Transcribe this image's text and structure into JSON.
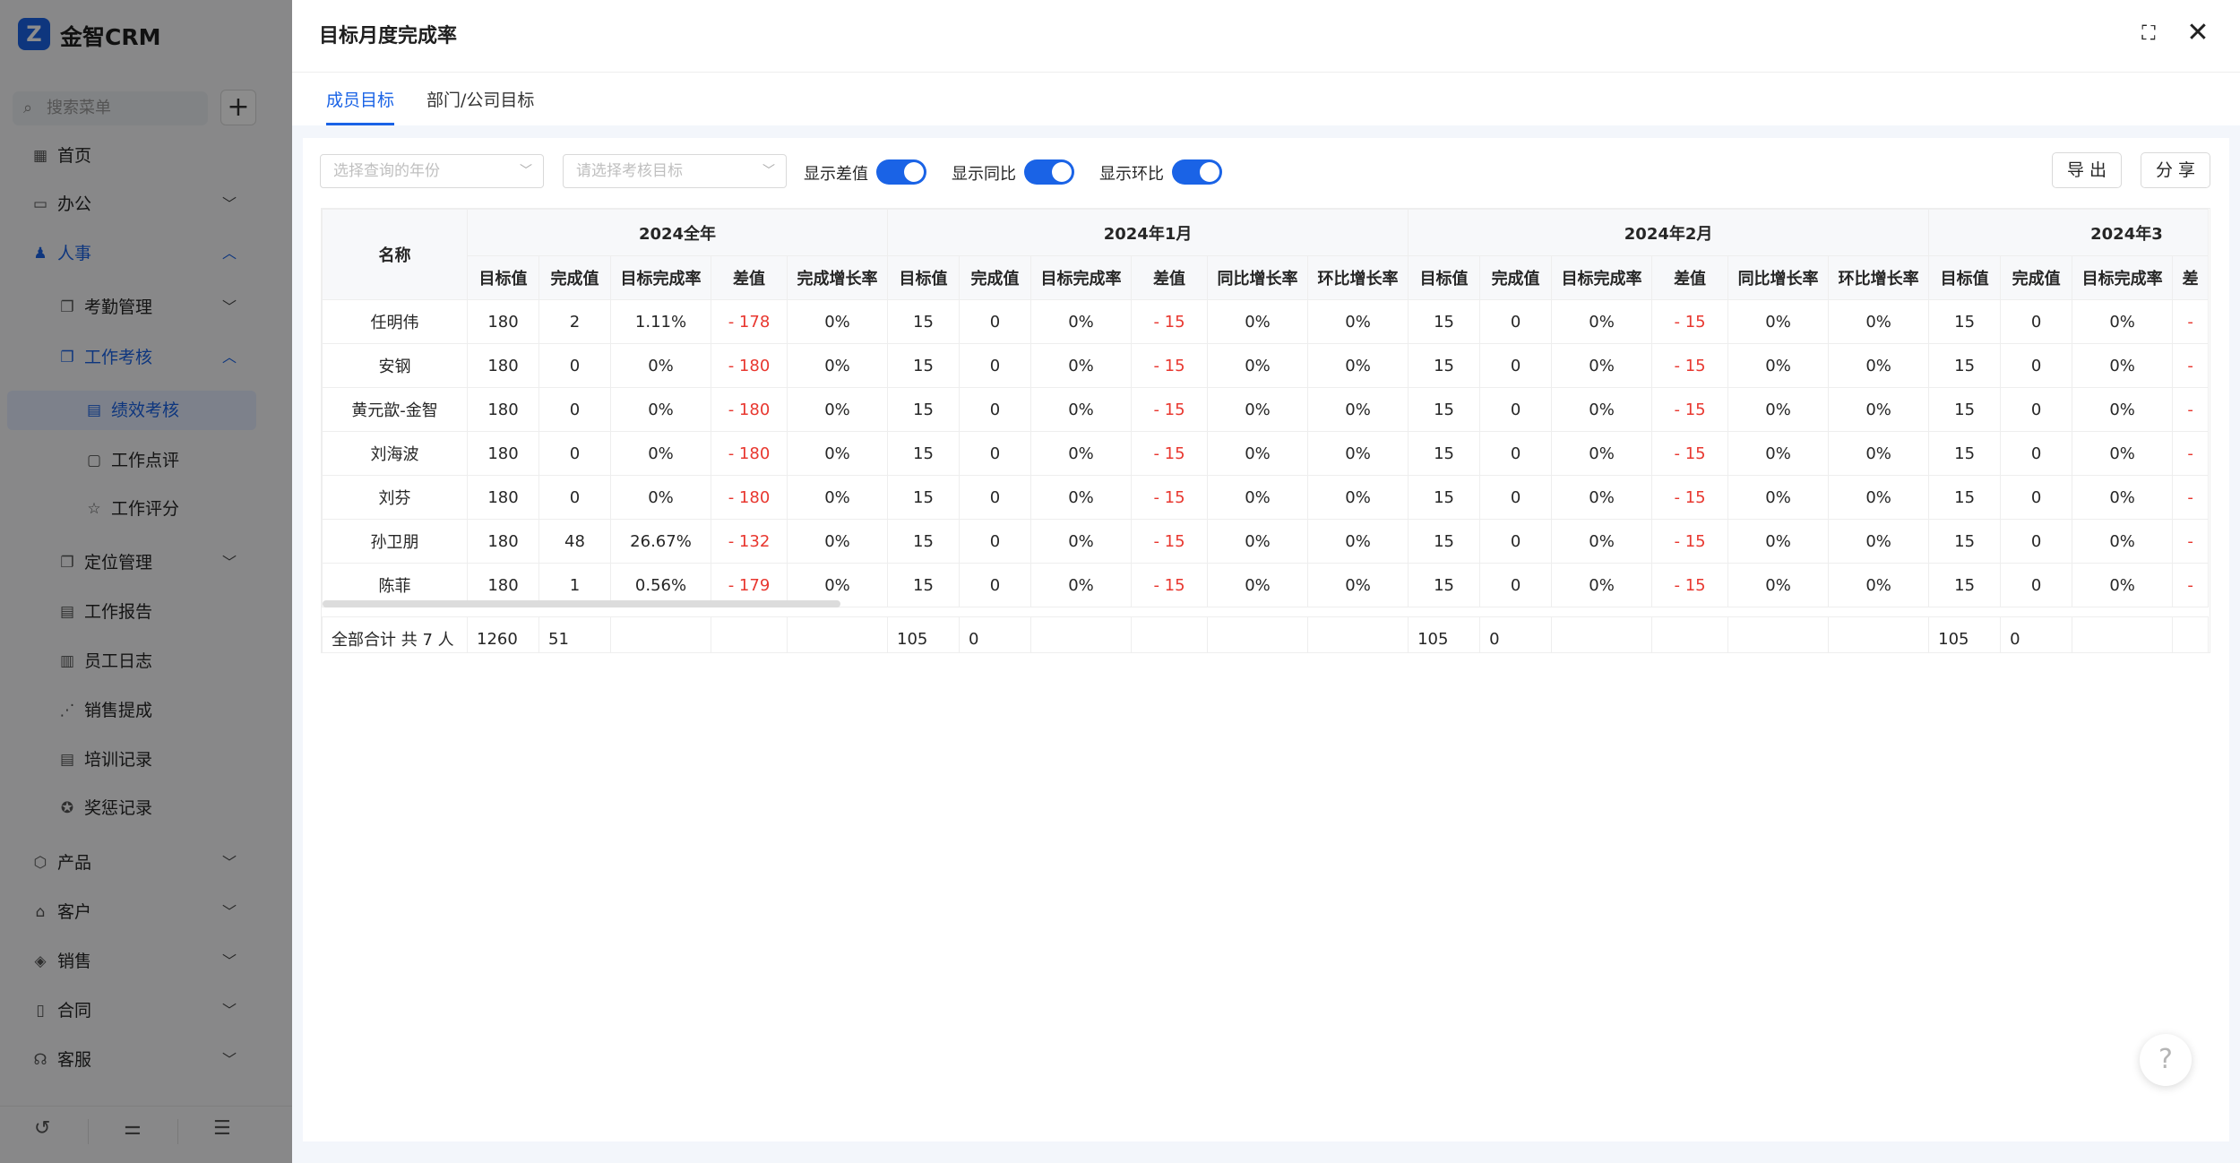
{
  "sidebar": {
    "brand": "金智CRM",
    "search_placeholder": "搜索菜单",
    "items": [
      {
        "label": "首页",
        "icon": "dashboard-icon"
      },
      {
        "label": "办公",
        "icon": "office-icon"
      },
      {
        "label": "人事",
        "icon": "people-icon"
      },
      {
        "label": "考勤管理",
        "icon": "copy-icon"
      },
      {
        "label": "工作考核",
        "icon": "copy-icon"
      },
      {
        "label": "绩效考核",
        "icon": "doc-icon"
      },
      {
        "label": "工作点评",
        "icon": "comment-icon"
      },
      {
        "label": "工作评分",
        "icon": "star-icon"
      },
      {
        "label": "定位管理",
        "icon": "copy-icon"
      },
      {
        "label": "工作报告",
        "icon": "doc-icon"
      },
      {
        "label": "员工日志",
        "icon": "calendar-icon"
      },
      {
        "label": "销售提成",
        "icon": "chart-icon"
      },
      {
        "label": "培训记录",
        "icon": "doc-icon"
      },
      {
        "label": "奖惩记录",
        "icon": "award-icon"
      },
      {
        "label": "产品",
        "icon": "box-icon"
      },
      {
        "label": "客户",
        "icon": "customer-icon"
      },
      {
        "label": "销售",
        "icon": "sales-icon"
      },
      {
        "label": "合同",
        "icon": "contract-icon"
      },
      {
        "label": "客服",
        "icon": "service-icon"
      }
    ]
  },
  "drawer": {
    "title": "目标月度完成率",
    "tabs": [
      "成员目标",
      "部门/公司目标"
    ]
  },
  "toolbar": {
    "year_placeholder": "选择查询的年份",
    "goal_placeholder": "请选择考核目标",
    "switches": [
      "显示差值",
      "显示同比",
      "显示环比"
    ],
    "export_label": "导 出",
    "share_label": "分 享"
  },
  "table": {
    "name_header": "名称",
    "groups": [
      "2024全年",
      "2024年1月",
      "2024年2月",
      "2024年3"
    ],
    "year_columns": [
      "目标值",
      "完成值",
      "目标完成率",
      "差值",
      "完成增长率"
    ],
    "month_columns": [
      "目标值",
      "完成值",
      "目标完成率",
      "差值",
      "同比增长率",
      "环比增长率"
    ],
    "partial_columns": [
      "目标值",
      "完成值",
      "目标完成率",
      "差"
    ],
    "rows": [
      {
        "name": "任明伟",
        "year": [
          "180",
          "2",
          "1.11%",
          "- 178",
          "0%"
        ],
        "month": [
          "15",
          "0",
          "0%",
          "- 15",
          "0%",
          "0%"
        ],
        "m3": [
          "15",
          "0",
          "0%",
          "-"
        ]
      },
      {
        "name": "安钢",
        "year": [
          "180",
          "0",
          "0%",
          "- 180",
          "0%"
        ],
        "month": [
          "15",
          "0",
          "0%",
          "- 15",
          "0%",
          "0%"
        ],
        "m3": [
          "15",
          "0",
          "0%",
          "-"
        ]
      },
      {
        "name": "黄元歆-金智",
        "year": [
          "180",
          "0",
          "0%",
          "- 180",
          "0%"
        ],
        "month": [
          "15",
          "0",
          "0%",
          "- 15",
          "0%",
          "0%"
        ],
        "m3": [
          "15",
          "0",
          "0%",
          "-"
        ]
      },
      {
        "name": "刘海波",
        "year": [
          "180",
          "0",
          "0%",
          "- 180",
          "0%"
        ],
        "month": [
          "15",
          "0",
          "0%",
          "- 15",
          "0%",
          "0%"
        ],
        "m3": [
          "15",
          "0",
          "0%",
          "-"
        ]
      },
      {
        "name": "刘芬",
        "year": [
          "180",
          "0",
          "0%",
          "- 180",
          "0%"
        ],
        "month": [
          "15",
          "0",
          "0%",
          "- 15",
          "0%",
          "0%"
        ],
        "m3": [
          "15",
          "0",
          "0%",
          "-"
        ]
      },
      {
        "name": "孙卫朋",
        "year": [
          "180",
          "48",
          "26.67%",
          "- 132",
          "0%"
        ],
        "month": [
          "15",
          "0",
          "0%",
          "- 15",
          "0%",
          "0%"
        ],
        "m3": [
          "15",
          "0",
          "0%",
          "-"
        ]
      },
      {
        "name": "陈菲",
        "year": [
          "180",
          "1",
          "0.56%",
          "- 179",
          "0%"
        ],
        "month": [
          "15",
          "0",
          "0%",
          "- 15",
          "0%",
          "0%"
        ],
        "m3": [
          "15",
          "0",
          "0%",
          "-"
        ]
      }
    ],
    "footer": {
      "label": "全部合计 共 7 人",
      "year": [
        "1260",
        "51"
      ],
      "m1": [
        "105",
        "0"
      ],
      "m2": [
        "105",
        "0"
      ],
      "m3": [
        "105",
        "0"
      ]
    }
  },
  "colors": {
    "accent": "#1a63e6",
    "negative": "#e8372f"
  }
}
